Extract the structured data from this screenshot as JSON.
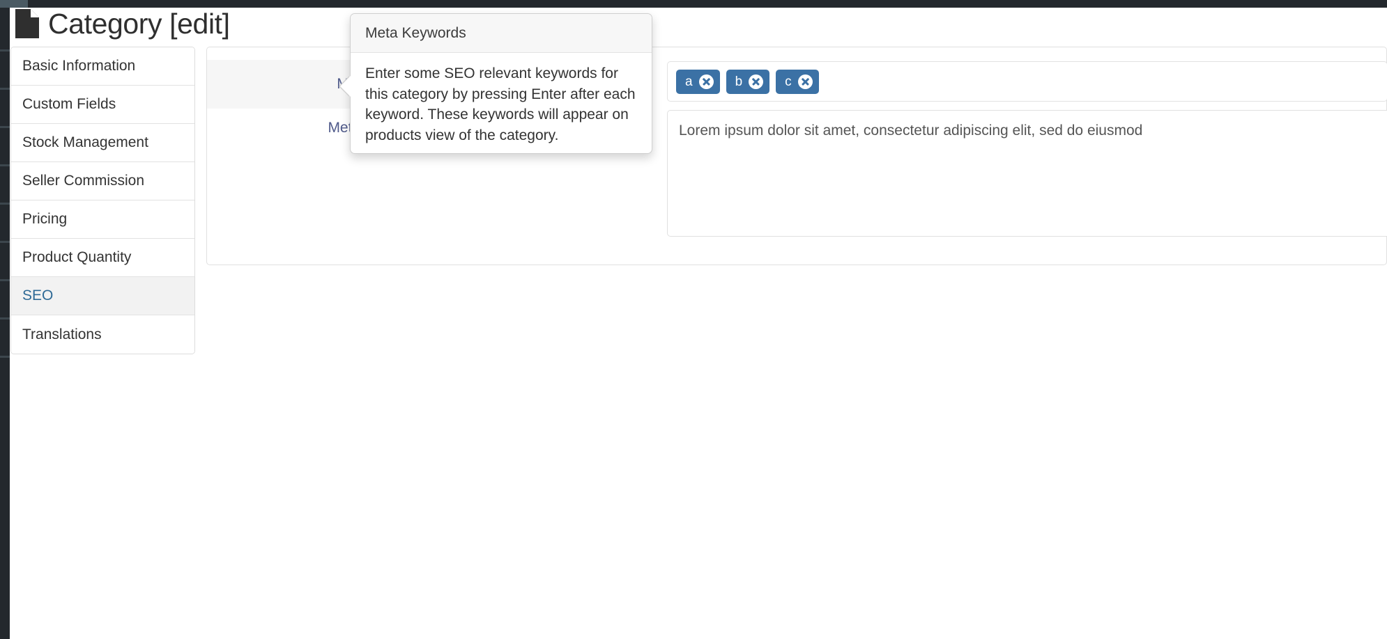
{
  "page": {
    "title": "Category [edit]",
    "title_icon": "document-icon"
  },
  "sidebar": {
    "items": [
      {
        "label": "Basic Information",
        "active": false
      },
      {
        "label": "Custom Fields",
        "active": false
      },
      {
        "label": "Stock Management",
        "active": false
      },
      {
        "label": "Seller Commission",
        "active": false
      },
      {
        "label": "Pricing",
        "active": false
      },
      {
        "label": "Product Quantity",
        "active": false
      },
      {
        "label": "SEO",
        "active": true
      },
      {
        "label": "Translations",
        "active": false
      }
    ]
  },
  "form": {
    "meta_keywords": {
      "label": "Meta Keywords",
      "help_icon": "question-mark-icon",
      "help_glyph": "?",
      "tags": [
        {
          "label": "a",
          "remove_icon": "close-circle-icon"
        },
        {
          "label": "b",
          "remove_icon": "close-circle-icon"
        },
        {
          "label": "c",
          "remove_icon": "close-circle-icon"
        }
      ]
    },
    "meta_description": {
      "label": "Meta Description",
      "help_icon": "question-mark-icon",
      "help_glyph": "?",
      "value": "Lorem ipsum dolor sit amet, consectetur adipiscing elit, sed do eiusmod",
      "placeholder": ""
    }
  },
  "popover": {
    "title": "Meta Keywords",
    "body": "Enter some SEO relevant keywords for this category by pressing Enter after each keyword. These keywords will appear on products view of the category."
  },
  "colors": {
    "accent_tag": "#3b71a5",
    "link": "#2f6a96",
    "label": "#4f5a8a",
    "chrome_dark": "#23282d"
  }
}
